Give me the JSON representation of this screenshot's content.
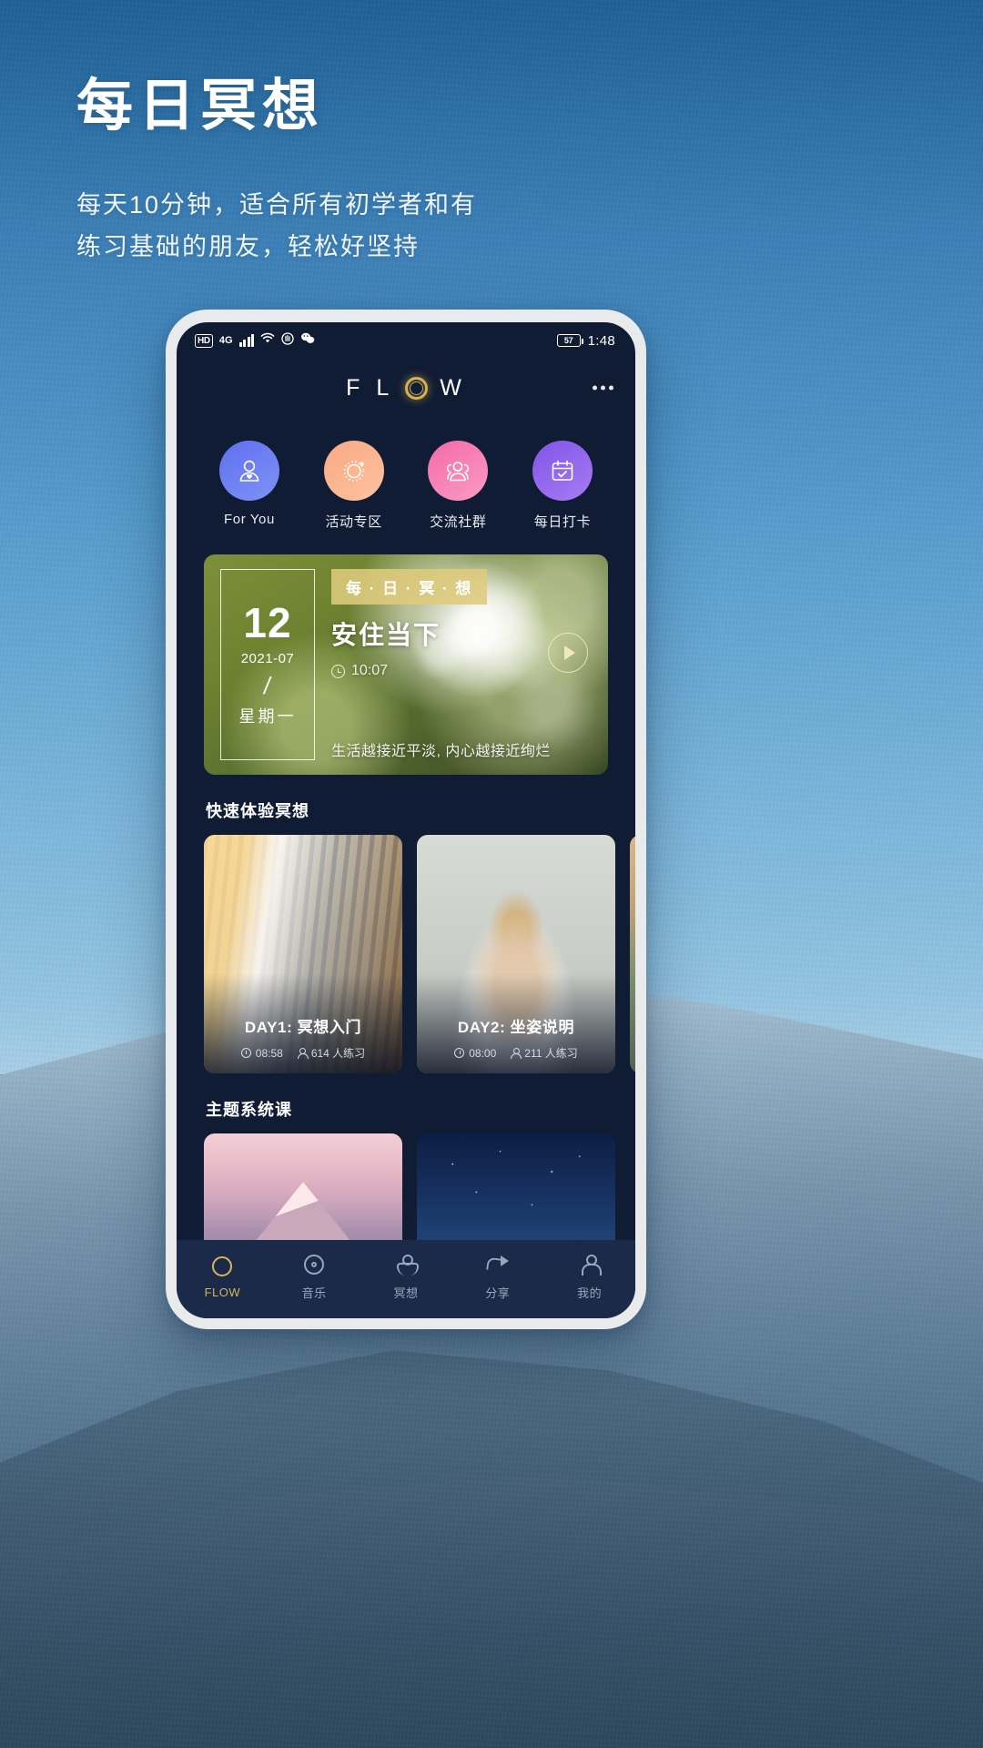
{
  "poster": {
    "title": "每日冥想",
    "subtitle_line1": "每天10分钟，适合所有初学者和有",
    "subtitle_line2": "练习基础的朋友，轻松好坚持",
    "bg_color": "#4a90c4"
  },
  "statusbar": {
    "hd": "HD",
    "network": "4G",
    "signal_icon": "signal-bars-icon",
    "wifi_icon": "wifi-icon",
    "dnd_icon": "do-not-disturb-icon",
    "wechat_icon": "wechat-icon",
    "battery_percent": "57",
    "time": "1:48"
  },
  "appbar": {
    "logo_f": "F",
    "logo_l": "L",
    "logo_w": "W",
    "logo_o_icon": "ring-logo-icon",
    "more_icon": "more-dots-icon",
    "accent": "#d8b24a"
  },
  "categories": [
    {
      "label": "For You",
      "icon": "person-heart-icon",
      "color": "#5f6ff0"
    },
    {
      "label": "活动专区",
      "icon": "dotted-circle-icon",
      "color": "#f9a983"
    },
    {
      "label": "交流社群",
      "icon": "people-group-icon",
      "color": "#f46aa8"
    },
    {
      "label": "每日打卡",
      "icon": "calendar-check-icon",
      "color": "#8055e8"
    }
  ],
  "daily_card": {
    "day": "12",
    "year_month": "2021-07",
    "separator": "/",
    "weekday": "星期一",
    "ribbon": "每 · 日 · 冥 · 想",
    "title": "安住当下",
    "duration": "10:07",
    "duration_icon": "clock-icon",
    "quote": "生活越接近平淡, 内心越接近绚烂",
    "play_icon": "play-circle-icon",
    "ribbon_color": "#decb7c"
  },
  "sections": {
    "quick": "快速体验冥想",
    "theme": "主题系统课"
  },
  "courses": [
    {
      "name": "DAY1: 冥想入门",
      "duration": "08:58",
      "practitioners": "614 人练习",
      "image": "autumn-forest-photo"
    },
    {
      "name": "DAY2: 坐姿说明",
      "duration": "08:00",
      "practitioners": "211 人练习",
      "image": "woman-meditating-photo"
    },
    {
      "name": "",
      "duration": "",
      "practitioners": "",
      "image": "lake-sunset-photo"
    }
  ],
  "themes": [
    {
      "image": "pink-mountain-photo"
    },
    {
      "image": "starry-night-photo"
    }
  ],
  "tabbar": [
    {
      "label": "FLOW",
      "icon": "ring-icon",
      "active": true
    },
    {
      "label": "音乐",
      "icon": "disc-icon",
      "active": false
    },
    {
      "label": "冥想",
      "icon": "meditation-icon",
      "active": false
    },
    {
      "label": "分享",
      "icon": "share-arrow-icon",
      "active": false
    },
    {
      "label": "我的",
      "icon": "profile-icon",
      "active": false
    }
  ]
}
